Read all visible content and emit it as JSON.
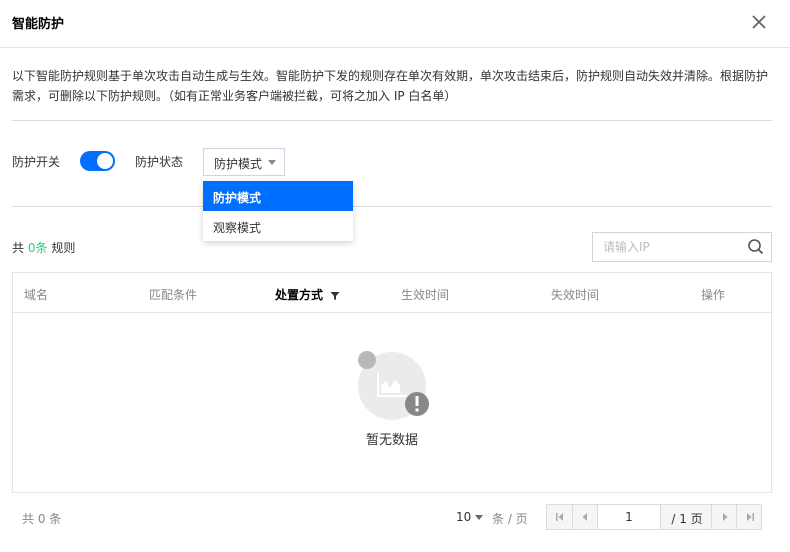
{
  "dialog": {
    "title": "智能防护",
    "description": "以下智能防护规则基于单次攻击自动生成与生效。智能防护下发的规则存在单次有效期，单次攻击结束后，防护规则自动失效并清除。根据防护需求，可删除以下防护规则。（如有正常业务客户端被拦截，可将之加入 IP 白名单）"
  },
  "controls": {
    "switch_label": "防护开关",
    "switch_on": true,
    "status_label": "防护状态",
    "status_value": "防护模式",
    "accent_color": "#006eff"
  },
  "dropdown": {
    "options": [
      "防护模式",
      "观察模式"
    ]
  },
  "list": {
    "count_prefix": "共",
    "count_value": "0条",
    "count_suffix": "规则",
    "search_placeholder": "请输入IP"
  },
  "table": {
    "columns": [
      "域名",
      "匹配条件",
      "处置方式",
      "生效时间",
      "失效时间",
      "操作"
    ],
    "empty_text": "暂无数据"
  },
  "footer": {
    "total_text": "共 0 条",
    "page_size": "10",
    "page_size_unit": "条 / 页",
    "current_page": "1",
    "total_pages": "/ 1 页"
  }
}
